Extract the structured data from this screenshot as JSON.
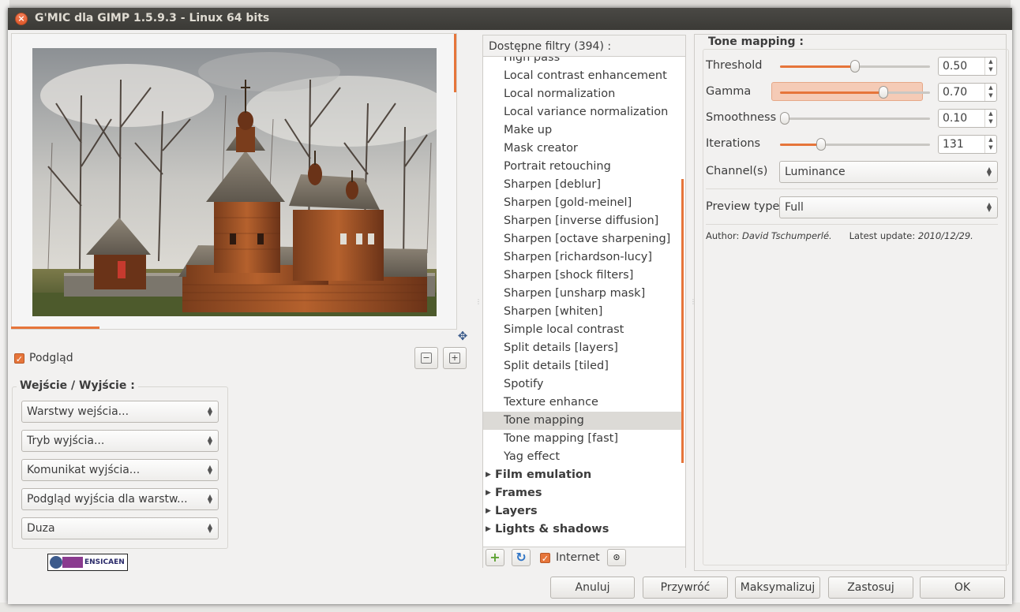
{
  "window": {
    "title": "G'MIC dla GIMP 1.5.9.3 - Linux 64 bits"
  },
  "preview": {
    "checkbox_label": "Podgląd",
    "checked": true
  },
  "io": {
    "title": "Wejście / Wyjście :",
    "combos": [
      "Warstwy wejścia...",
      "Tryb wyjścia...",
      "Komunikat wyjścia...",
      "Podgląd wyjścia dla warstw...",
      "Duza"
    ]
  },
  "logo": {
    "text": "ENSICAEN"
  },
  "filters": {
    "header": "Dostępne filtry (394) :",
    "items": [
      {
        "label": "High pass",
        "type": "leaf"
      },
      {
        "label": "Local contrast enhancement",
        "type": "leaf"
      },
      {
        "label": "Local normalization",
        "type": "leaf"
      },
      {
        "label": "Local variance normalization",
        "type": "leaf"
      },
      {
        "label": "Make up",
        "type": "leaf"
      },
      {
        "label": "Mask creator",
        "type": "leaf"
      },
      {
        "label": "Portrait retouching",
        "type": "leaf"
      },
      {
        "label": "Sharpen [deblur]",
        "type": "leaf"
      },
      {
        "label": "Sharpen [gold-meinel]",
        "type": "leaf"
      },
      {
        "label": "Sharpen [inverse diffusion]",
        "type": "leaf"
      },
      {
        "label": "Sharpen [octave sharpening]",
        "type": "leaf"
      },
      {
        "label": "Sharpen [richardson-lucy]",
        "type": "leaf"
      },
      {
        "label": "Sharpen [shock filters]",
        "type": "leaf"
      },
      {
        "label": "Sharpen [unsharp mask]",
        "type": "leaf"
      },
      {
        "label": "Sharpen [whiten]",
        "type": "leaf"
      },
      {
        "label": "Simple local contrast",
        "type": "leaf"
      },
      {
        "label": "Split details [layers]",
        "type": "leaf"
      },
      {
        "label": "Split details [tiled]",
        "type": "leaf"
      },
      {
        "label": "Spotify",
        "type": "leaf"
      },
      {
        "label": "Texture enhance",
        "type": "leaf"
      },
      {
        "label": "Tone mapping",
        "type": "leaf",
        "selected": true
      },
      {
        "label": "Tone mapping [fast]",
        "type": "leaf"
      },
      {
        "label": "Yag effect",
        "type": "leaf"
      },
      {
        "label": "Film emulation",
        "type": "category"
      },
      {
        "label": "Frames",
        "type": "category"
      },
      {
        "label": "Layers",
        "type": "category"
      },
      {
        "label": "Lights & shadows",
        "type": "category"
      }
    ],
    "internet_label": "Internet",
    "internet_checked": true
  },
  "settings": {
    "title": "Tone mapping :",
    "params": [
      {
        "label": "Threshold",
        "value": "0.50",
        "fraction": 0.5
      },
      {
        "label": "Gamma",
        "value": "0.70",
        "fraction": 0.7
      },
      {
        "label": "Smoothness",
        "value": "0.10",
        "fraction": 0.0
      },
      {
        "label": "Iterations",
        "value": "131",
        "fraction": 0.26
      }
    ],
    "channels_label": "Channel(s)",
    "channels_value": "Luminance",
    "preview_type_label": "Preview type",
    "preview_type_value": "Full",
    "author_label": "Author:",
    "author_name": "David Tschumperlé.",
    "update_label": "Latest update:",
    "update_date": "2010/12/29."
  },
  "buttons": {
    "cancel": "Anuluj",
    "reset": "Przywróć",
    "maximize": "Maksymalizuj",
    "apply": "Zastosuj",
    "ok": "OK"
  },
  "colors": {
    "accent": "#e6753a",
    "titlebar": "#3c3b37"
  }
}
